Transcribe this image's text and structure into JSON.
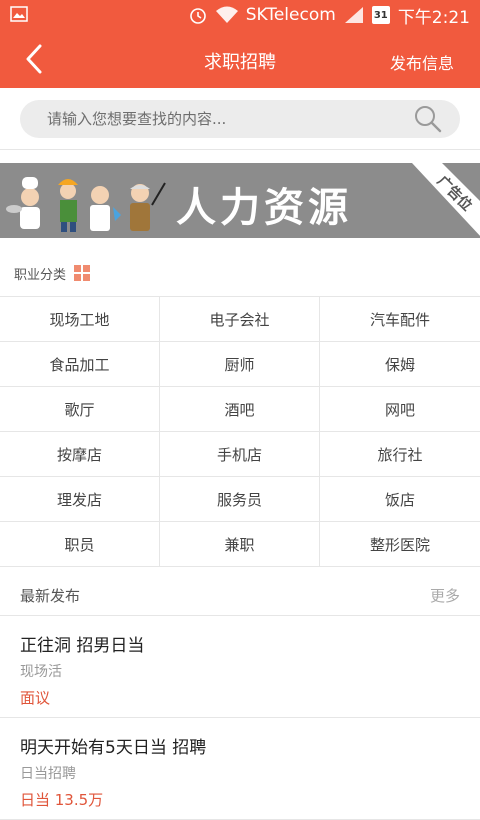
{
  "status_bar": {
    "carrier": "SKTelecom",
    "calendar_day": "31",
    "time": "下午2:21"
  },
  "header": {
    "title": "求职招聘",
    "action": "发布信息"
  },
  "search": {
    "placeholder": "请输入您想要查找的内容..."
  },
  "banner": {
    "title": "人力资源",
    "badge": "广告位",
    "background_color": "#8c8c8c"
  },
  "categories": {
    "label": "职业分类",
    "items": [
      "现场工地",
      "电子会社",
      "汽车配件",
      "食品加工",
      "厨师",
      "保姆",
      "歌厅",
      "酒吧",
      "网吧",
      "按摩店",
      "手机店",
      "旅行社",
      "理发店",
      "服务员",
      "饭店",
      "职员",
      "兼职",
      "整形医院"
    ]
  },
  "latest": {
    "title": "最新发布",
    "more": "更多",
    "posts": [
      {
        "title": "正往洞 招男日当",
        "subtitle": "现场活",
        "pay": "面议"
      },
      {
        "title": "明天开始有5天日当 招聘",
        "subtitle": "日当招聘",
        "pay": "日当 13.5万"
      }
    ]
  },
  "colors": {
    "accent": "#f15a3e",
    "pay_text": "#e0553a"
  }
}
